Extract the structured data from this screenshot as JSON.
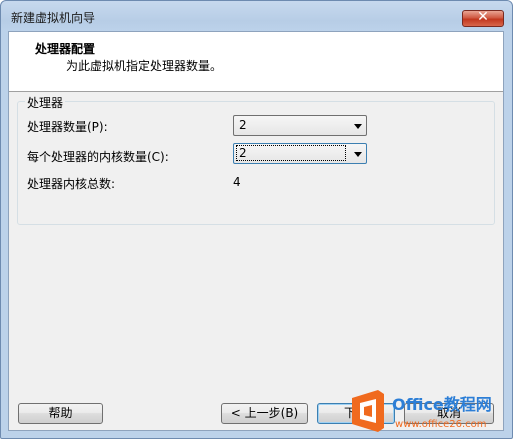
{
  "window": {
    "title": "新建虚拟机向导",
    "close_glyph": "✕"
  },
  "header": {
    "title": "处理器配置",
    "subtitle": "为此虚拟机指定处理器数量。"
  },
  "group": {
    "legend": "处理器",
    "processor_count_label": "处理器数量(P):",
    "processor_count_value": "2",
    "cores_label": "每个处理器的内核数量(C):",
    "cores_value": "2",
    "total_label": "处理器内核总数:",
    "total_value": "4"
  },
  "buttons": {
    "help": "帮助",
    "back": "< 上一步(B)",
    "next": "下一",
    "cancel": "取消"
  },
  "watermark": {
    "brand": "Office教程网",
    "url": "www.office26.com"
  }
}
